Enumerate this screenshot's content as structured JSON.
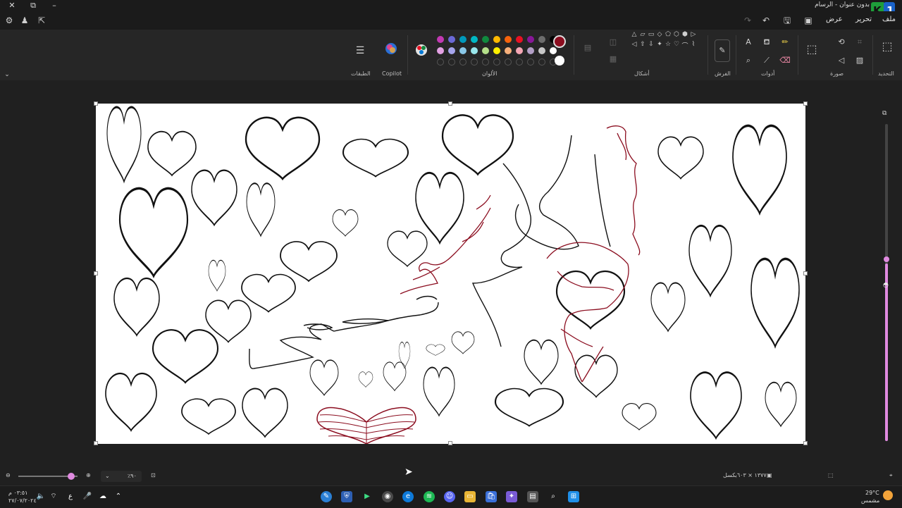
{
  "window": {
    "title": "بدون عنوان - الرسام",
    "close_symbol": "✕",
    "maximize_symbol": "⧉",
    "minimize_symbol": "–"
  },
  "menu": {
    "file": "ملف",
    "edit": "تحرير",
    "view": "عرض"
  },
  "ribbon": {
    "groups": {
      "select": "التحديد",
      "image": "صورة",
      "tools": "أدوات",
      "brushes": "الفرش",
      "shapes": "أشكال",
      "colors": "الألوان",
      "copilot": "Copilot",
      "layers": "الطبقات"
    },
    "colors": {
      "row1": [
        "#c239b3",
        "#6b69d6",
        "#0099bc",
        "#00b7c3",
        "#10893e",
        "#ffb900",
        "#f7630c",
        "#e81123",
        "#881798",
        "#6d6d6d",
        "#000000"
      ],
      "row2": [
        "#e3a1e3",
        "#a6a5ec",
        "#8ac8e8",
        "#99e6eb",
        "#b4e08a",
        "#fff100",
        "#f7b07b",
        "#f4a6b4",
        "#b39fc6",
        "#c8c8c8",
        "#ffffff"
      ],
      "empty_count": 11,
      "primary": "#8b0d1f",
      "secondary": "#ffffff"
    },
    "shape_glyphs": [
      "△",
      "▱",
      "▭",
      "◇",
      "⬠",
      "⬡",
      "⬢",
      "▷",
      "◁",
      "⇧",
      "⇩",
      "✦",
      "☆",
      "♡",
      "⌒",
      "⌇"
    ]
  },
  "status": {
    "zoom": "٪٩٠",
    "dimensions": "١٣٧٧ × ٦٠٣بكسل"
  },
  "taskbar": {
    "weather_temp": "29°C",
    "weather_desc": "مشمس",
    "time": "٠٣:٥١ م",
    "date": "٢٧/٠٧/٢٠٢٤"
  },
  "colors": {
    "accent": "#e08ae0",
    "ink_black": "#111111",
    "ink_red": "#8b0d1f"
  }
}
